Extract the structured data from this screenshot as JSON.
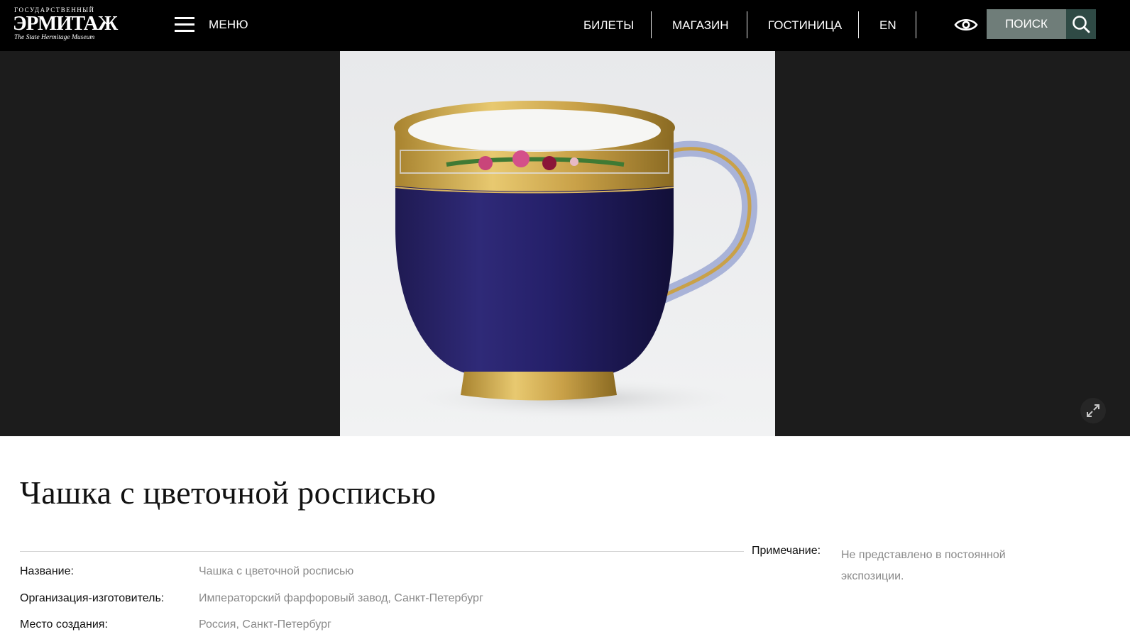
{
  "header": {
    "logo": {
      "top_line": "ГОСУДАРСТВЕННЫЙ",
      "main": "ЭРМИТАЖ",
      "sub": "The State Hermitage Museum"
    },
    "menu_label": "МЕНЮ",
    "nav": [
      {
        "label": "БИЛЕТЫ"
      },
      {
        "label": "МАГАЗИН"
      },
      {
        "label": "ГОСТИНИЦА"
      },
      {
        "label": "EN"
      }
    ],
    "search_label": "ПОИСК",
    "icons": {
      "menu": "hamburger-icon",
      "accessibility": "eye-icon",
      "search": "search-icon",
      "expand": "expand-icon"
    }
  },
  "object": {
    "title": "Чашка с цветочной росписью",
    "details": [
      {
        "label": "Название:",
        "value": "Чашка с цветочной росписью"
      },
      {
        "label": "Организация-изготовитель:",
        "value": "Императорский фарфоровый завод, Санкт-Петербург"
      },
      {
        "label": "Место создания:",
        "value_parts": [
          "Россия",
          ", ",
          "Санкт-Петербург"
        ]
      }
    ],
    "note": {
      "label": "Примечание:",
      "value": "Не представлено в постоянной экспозиции."
    }
  },
  "colors": {
    "header_bg": "#000000",
    "hero_bg": "#1c1c1c",
    "search_bg": "#6f7d79",
    "search_icon_bg": "#2f4a45",
    "muted_text": "#8a8a8a"
  }
}
